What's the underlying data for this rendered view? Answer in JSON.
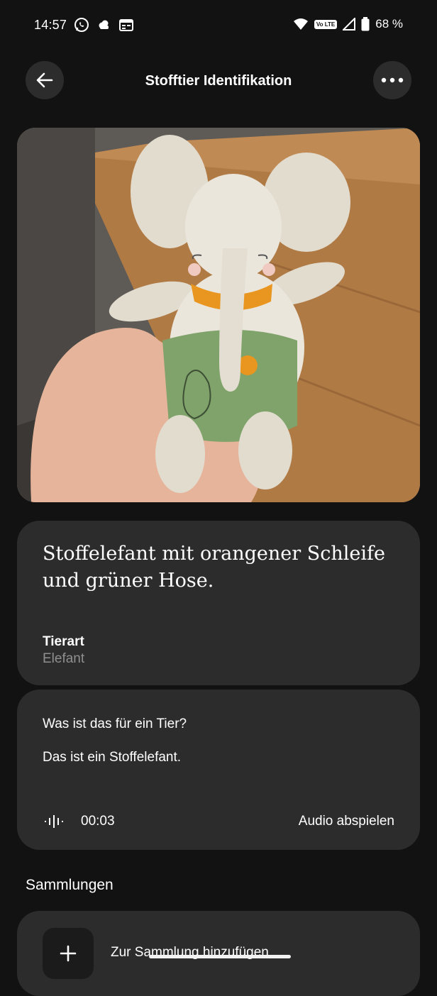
{
  "status_bar": {
    "time": "14:57",
    "left_icons": [
      "whatsapp-icon",
      "cloud-icon",
      "calendar-icon"
    ],
    "volte": "Vo LTE",
    "battery_text": "68 %"
  },
  "app_bar": {
    "title": "Stofftier Identifikation",
    "back_icon": "back-arrow-icon",
    "more_icon": "more-dots-icon"
  },
  "photo": {
    "subject": "stuffed-elephant-photo",
    "colors": {
      "body": "#e8e2d6",
      "scarf": "#e8961f",
      "pants": "#7fa36a",
      "table": "#b07a45"
    }
  },
  "description": {
    "text": "Stoffelefant mit orangener Schleife und grüner Hose.",
    "tier_label": "Tierart",
    "tier_value": "Elefant"
  },
  "qa": {
    "question": "Was ist das für ein Tier?",
    "answer": "Das ist ein Stoffelefant.",
    "audio_duration": "00:03",
    "audio_play_label": "Audio abspielen",
    "audio_icon": "waveform-icon"
  },
  "collections": {
    "title": "Sammlungen",
    "add_label": "Zur Sammlung hinzufügen",
    "add_icon": "plus-icon"
  },
  "colors": {
    "background": "#121212",
    "card": "#2c2c2c",
    "muted_text": "#8f8f8f"
  }
}
